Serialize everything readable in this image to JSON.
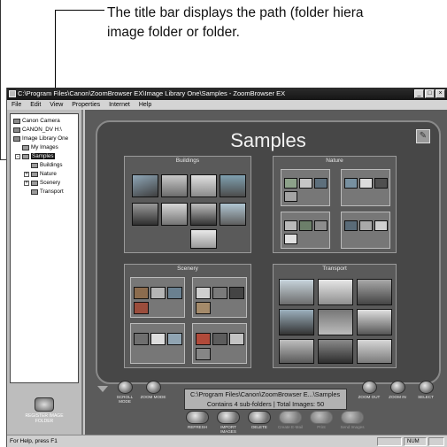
{
  "caption": {
    "line1": "The title bar displays the path (folder hiera",
    "line2": "image folder or folder."
  },
  "window": {
    "title": "C:\\Program Files\\Canon\\ZoomBrowser EX\\Image Library One\\Samples - ZoomBrowser EX",
    "controls": [
      "_",
      "□",
      "×"
    ]
  },
  "menu": [
    "File",
    "Edit",
    "View",
    "Properties",
    "Internet",
    "Help"
  ],
  "tree": {
    "items": [
      {
        "label": "Canon Camera",
        "indent": 0,
        "icon": "camera-icon"
      },
      {
        "label": "CANON_DV H:\\",
        "indent": 0,
        "icon": "drive-icon"
      },
      {
        "label": "Image Library One",
        "indent": 0,
        "icon": "library-icon"
      },
      {
        "label": "My Images",
        "indent": 1,
        "icon": "folder-icon"
      },
      {
        "label": "Samples",
        "indent": 1,
        "icon": "folder-icon",
        "selected": true,
        "expander": "-"
      },
      {
        "label": "Buildings",
        "indent": 2,
        "icon": "folder-icon"
      },
      {
        "label": "Nature",
        "indent": 2,
        "icon": "folder-icon",
        "expander": "+"
      },
      {
        "label": "Scenery",
        "indent": 2,
        "icon": "folder-icon",
        "expander": "+"
      },
      {
        "label": "Transport",
        "indent": 2,
        "icon": "folder-icon"
      }
    ],
    "register_button": "REGISTER IMAGE FOLDER"
  },
  "main": {
    "title": "Samples",
    "groups": [
      {
        "label": "Buildings",
        "id": "buildings"
      },
      {
        "label": "Nature",
        "id": "nature"
      },
      {
        "label": "Scenery",
        "id": "scenery"
      },
      {
        "label": "Transport",
        "id": "transport"
      }
    ]
  },
  "controls": {
    "scroll_mode": "SCROLL MODE",
    "zoom_mode": "ZOOM MODE",
    "zoom_out": "ZOOM OUT",
    "zoom_in": "ZOOM IN",
    "select": "SELECT",
    "refresh": "REFRESH",
    "import_images": "IMPORT IMAGES",
    "delete": "DELETE",
    "btn_dim_1": "Create E-Mail",
    "btn_dim_2": "Print",
    "btn_dim_3": "Send Images"
  },
  "info": {
    "path": "C:\\Program Files\\Canon\\ZoomBrowser E...\\Samples",
    "summary": "Contains 4 sub-folders | Total Images: 50"
  },
  "status": {
    "message": "For Help, press F1",
    "num": "NUM"
  },
  "colors": {
    "main_bg": "#5b5b5b",
    "panel_bg": "#474747",
    "titlebar": "#1e1e1e"
  }
}
